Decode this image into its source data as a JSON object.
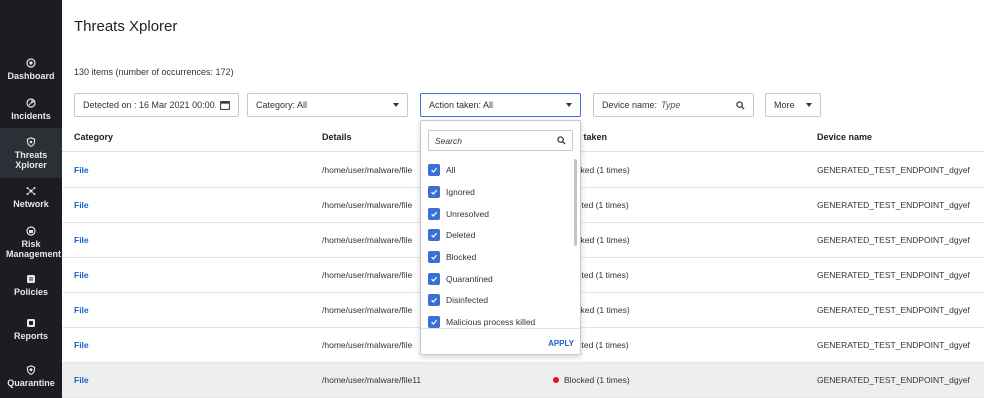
{
  "sidebar": {
    "items": [
      {
        "label": "Dashboard",
        "icon": "dashboard-icon"
      },
      {
        "label": "Incidents",
        "icon": "incidents-icon"
      },
      {
        "label": "Threats Xplorer",
        "icon": "threats-icon",
        "active": true
      },
      {
        "label": "Network",
        "icon": "network-icon"
      },
      {
        "label": "Risk Management",
        "icon": "risk-icon"
      },
      {
        "label": "Policies",
        "icon": "policies-icon"
      },
      {
        "label": "Reports",
        "icon": "reports-icon"
      },
      {
        "label": "Quarantine",
        "icon": "quarantine-icon"
      }
    ]
  },
  "page": {
    "title": "Threats Xplorer",
    "count": "130 items (number of occurrences: 172)"
  },
  "filters": {
    "detected": "Detected on : 16 Mar 2021 00:00...",
    "category": "Category: All",
    "action": "Action taken: All",
    "device_label": "Device name:",
    "device_placeholder": "Type",
    "more": "More"
  },
  "table": {
    "headers": {
      "category": "Category",
      "details": "Details",
      "action": "Action taken",
      "device": "Device name"
    },
    "rows": [
      {
        "category": "File",
        "details": "/home/user/malware/file",
        "action": "Blocked (1 times)",
        "device": "GENERATED_TEST_ENDPOINT_dgyef"
      },
      {
        "category": "File",
        "details": "/home/user/malware/file",
        "action": "Deleted (1 times)",
        "device": "GENERATED_TEST_ENDPOINT_dgyef"
      },
      {
        "category": "File",
        "details": "/home/user/malware/file",
        "action": "Blocked (1 times)",
        "device": "GENERATED_TEST_ENDPOINT_dgyef"
      },
      {
        "category": "File",
        "details": "/home/user/malware/file",
        "action": "Deleted (1 times)",
        "device": "GENERATED_TEST_ENDPOINT_dgyef"
      },
      {
        "category": "File",
        "details": "/home/user/malware/file",
        "action": "Blocked (1 times)",
        "device": "GENERATED_TEST_ENDPOINT_dgyef"
      },
      {
        "category": "File",
        "details": "/home/user/malware/file",
        "action": "Deleted (1 times)",
        "device": "GENERATED_TEST_ENDPOINT_dgyef"
      },
      {
        "category": "File",
        "details": "/home/user/malware/file11",
        "action": "Blocked (1 times)",
        "device": "GENERATED_TEST_ENDPOINT_dgyef"
      }
    ]
  },
  "dropdown": {
    "search_placeholder": "Search",
    "options": [
      "All",
      "Ignored",
      "Unresolved",
      "Deleted",
      "Blocked",
      "Quarantined",
      "Disinfected",
      "Malicious process killed"
    ],
    "apply": "APPLY"
  },
  "colors": {
    "sidebar_bg": "#1c1d21",
    "accent": "#3a6fd8",
    "link": "#1a5fcf",
    "status_red": "#e0141b"
  }
}
